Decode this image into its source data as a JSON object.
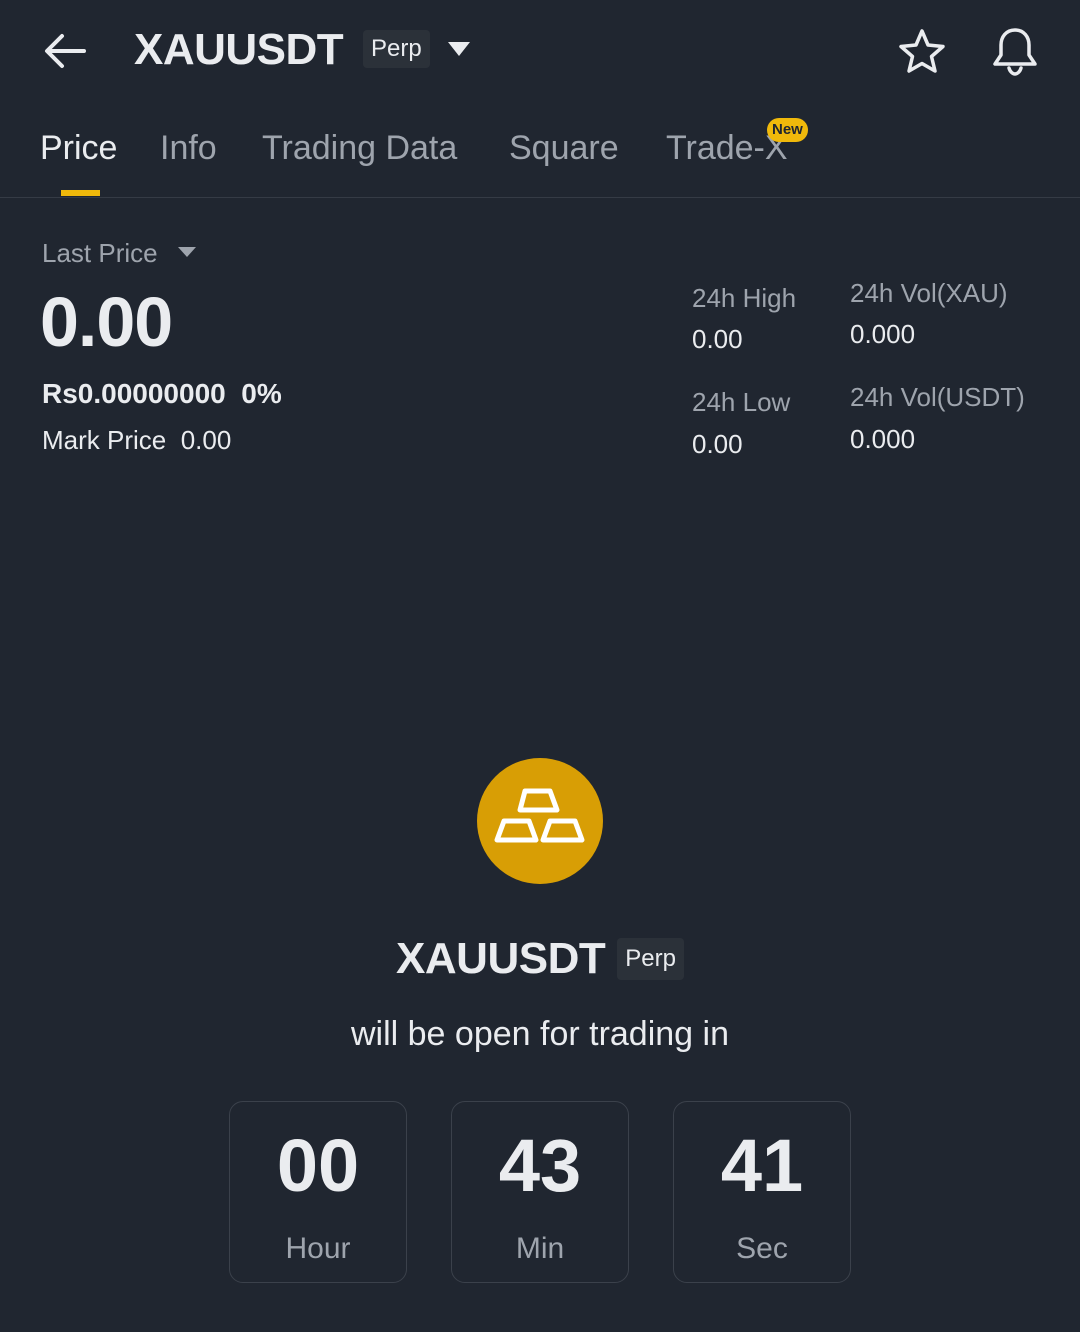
{
  "header": {
    "symbol": "XAUUSDT",
    "contract_type": "Perp",
    "icons": [
      "back-arrow-icon",
      "dropdown-triangle-icon",
      "star-icon",
      "bell-icon"
    ]
  },
  "tabs": [
    {
      "label": "Price",
      "active": true
    },
    {
      "label": "Info",
      "active": false
    },
    {
      "label": "Trading Data",
      "active": false
    },
    {
      "label": "Square",
      "active": false
    },
    {
      "label": "Trade-X",
      "active": false,
      "badge": "New"
    }
  ],
  "price": {
    "last_price_label": "Last Price",
    "last_price": "0.00",
    "fiat_price": "Rs0.00000000",
    "change_pct": "0%",
    "mark_price_label": "Mark Price",
    "mark_price": "0.00"
  },
  "stats": {
    "high_label": "24h High",
    "high_value": "0.00",
    "low_label": "24h Low",
    "low_value": "0.00",
    "vol_base_label": "24h Vol(XAU)",
    "vol_base_value": "0.000",
    "vol_quote_label": "24h Vol(USDT)",
    "vol_quote_value": "0.000"
  },
  "launch": {
    "symbol": "XAUUSDT",
    "contract_type": "Perp",
    "message": "will be open for trading in",
    "countdown": {
      "hour": "00",
      "hour_label": "Hour",
      "min": "43",
      "min_label": "Min",
      "sec": "41",
      "sec_label": "Sec"
    }
  },
  "colors": {
    "background": "#202630",
    "accent": "#f0b90b",
    "gold_coin": "#d89e05",
    "text_primary": "#eaecef",
    "text_secondary": "#9ea4ad"
  }
}
